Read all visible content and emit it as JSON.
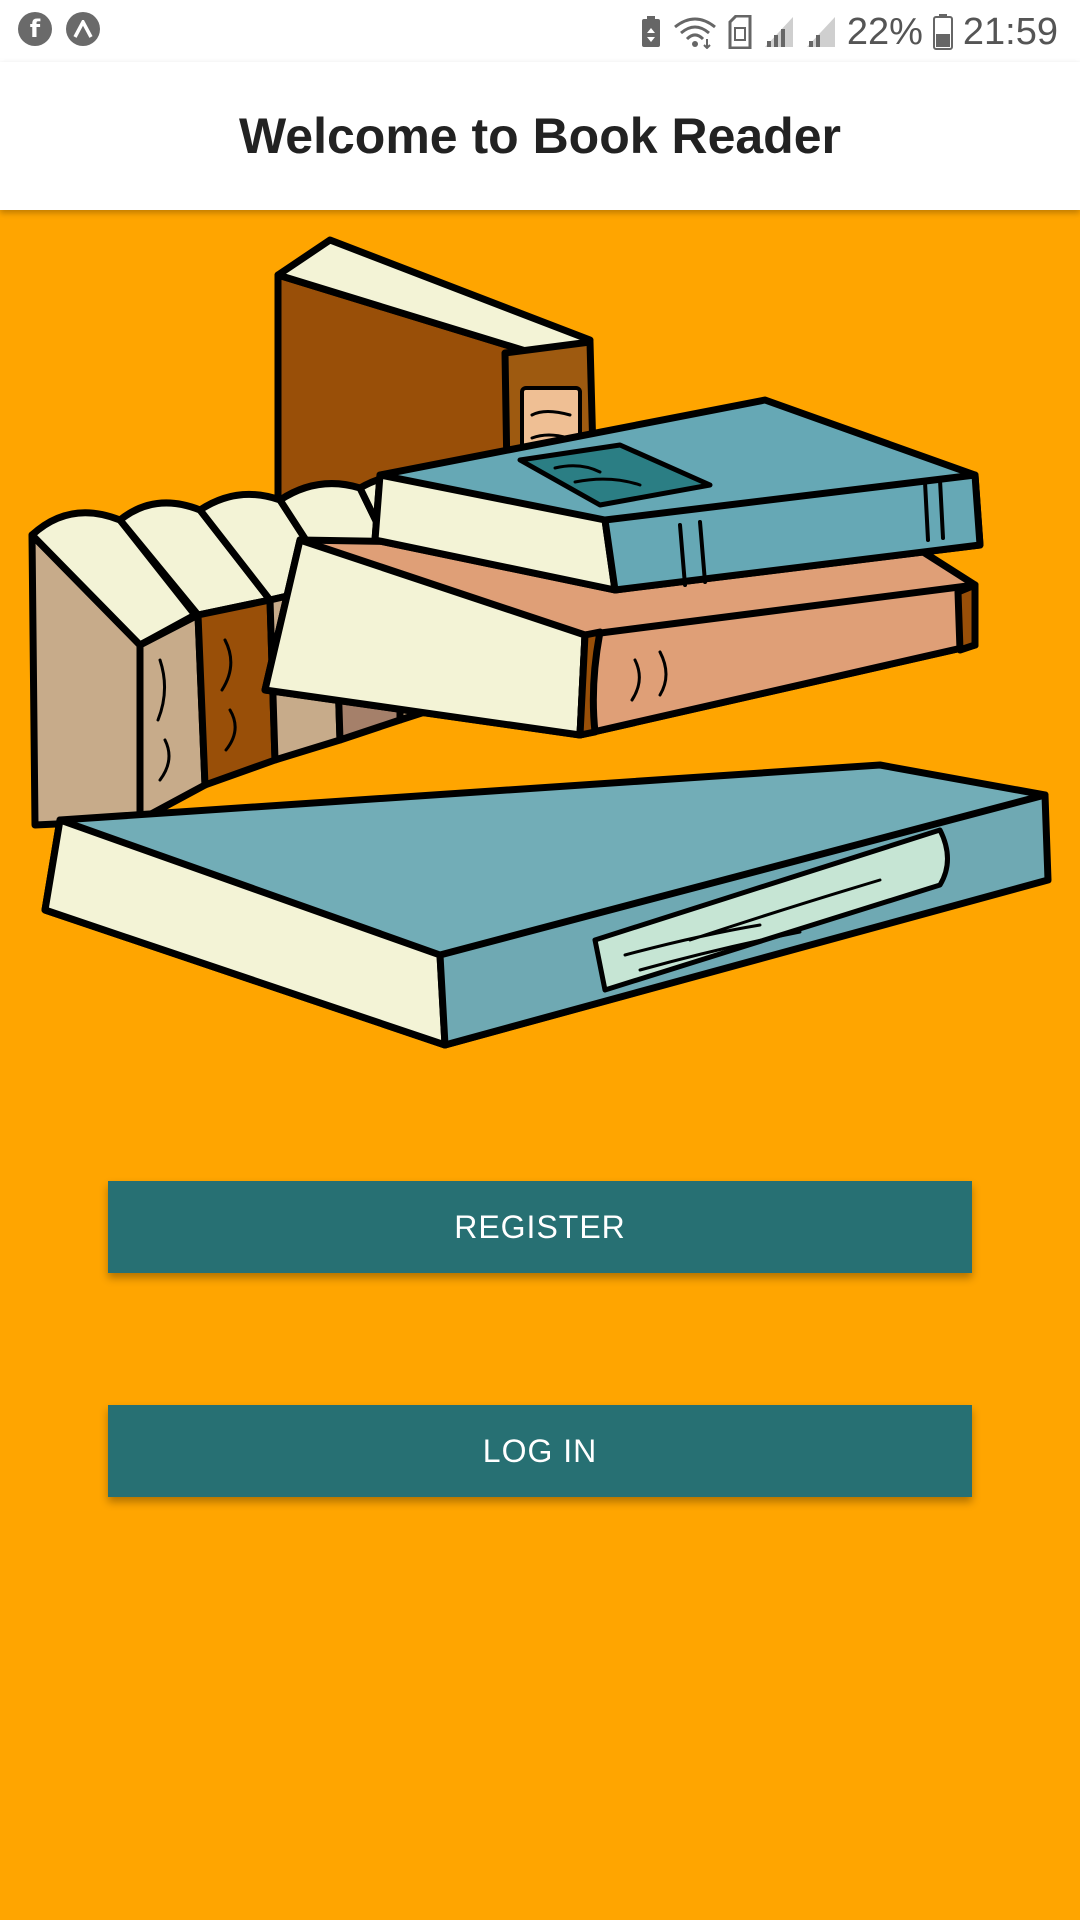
{
  "status_bar": {
    "left_icons": [
      "facebook-icon",
      "app-notification-icon"
    ],
    "right_icons": [
      "battery-saver-icon",
      "wifi-icon",
      "sim-card-icon",
      "signal-icon",
      "signal-icon",
      "battery-icon"
    ],
    "battery_percent": "22%",
    "time": "21:59"
  },
  "app_bar": {
    "title": "Welcome to Book Reader"
  },
  "illustration": {
    "icon": "books-stack-illustration"
  },
  "buttons": {
    "register_label": "REGISTER",
    "login_label": "LOG IN"
  },
  "colors": {
    "background": "#ffa500",
    "button": "#277073",
    "button_text": "#ffffff",
    "app_bar": "#ffffff",
    "title_text": "#222222"
  }
}
